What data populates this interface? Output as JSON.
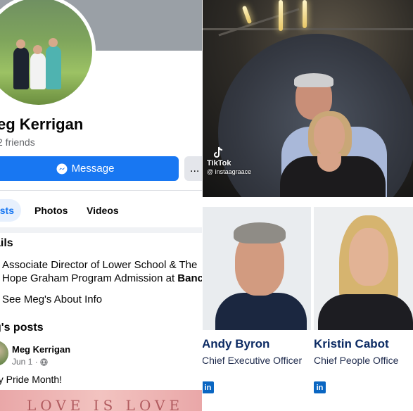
{
  "facebook_profile": {
    "name": "eg Kerrigan",
    "friends": "2 friends",
    "message_button": "Message",
    "more_button": "...",
    "tabs": [
      "sts",
      "Photos",
      "Videos"
    ],
    "details_heading": "ails",
    "detail_line1": "Associate Director of Lower School & The",
    "detail_line2_prefix": "Hope Graham Program Admission at ",
    "detail_line2_bold": "Banc",
    "about_link": "See Meg's About Info",
    "posts_heading": "g's posts",
    "post": {
      "author": "Meg Kerrigan",
      "date": "Jun 1 ·",
      "text": "py Pride Month!",
      "banner_text": "LOVE IS LOVE"
    }
  },
  "concert": {
    "tiktok_brand": "TikTok",
    "tiktok_handle": "@ instaagraace"
  },
  "executives": [
    {
      "name": "Andy Byron",
      "title": "Chief Executive Officer",
      "link_icon": "linkedin-icon"
    },
    {
      "name": "Kristin Cabot",
      "title": "Chief People Office",
      "link_icon": "linkedin-icon"
    }
  ],
  "colors": {
    "facebook_blue": "#1877f2",
    "exec_name": "#0b2a63",
    "linkedin_blue": "#0a66c2"
  }
}
